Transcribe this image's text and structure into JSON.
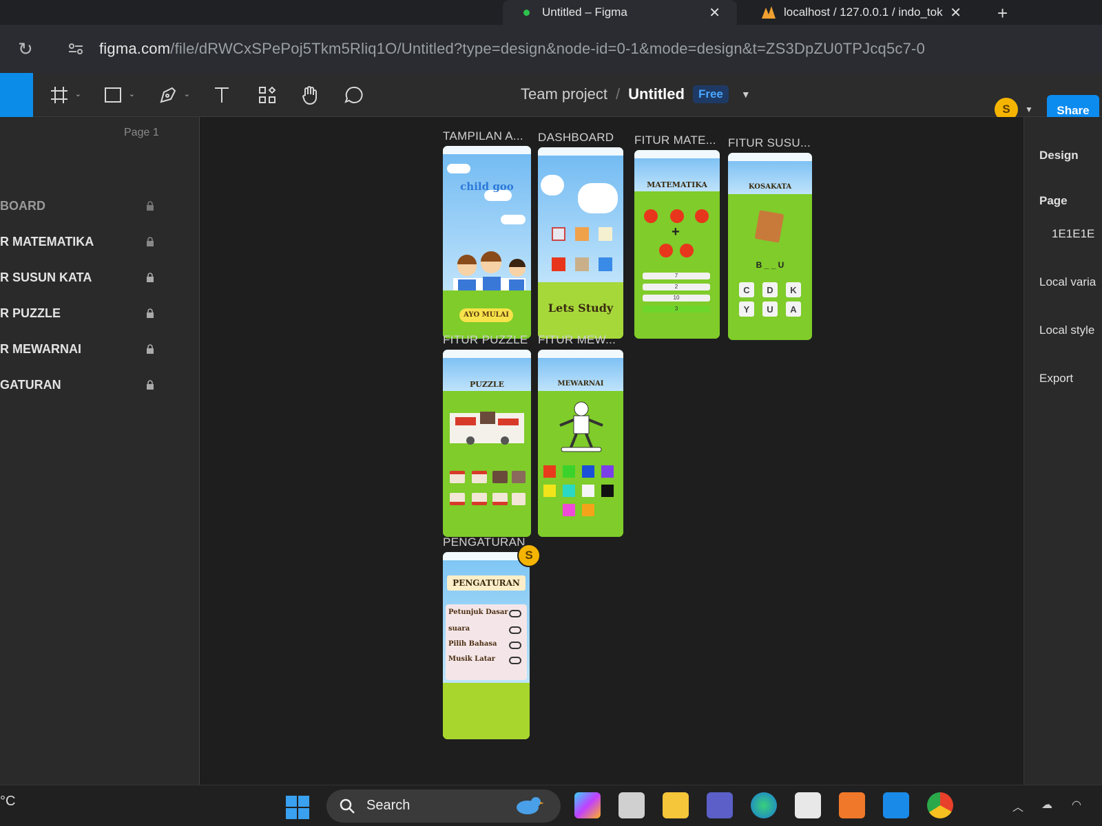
{
  "browser": {
    "tabs": [
      {
        "label": "Untitled – Figma"
      },
      {
        "label": "localhost / 127.0.0.1 / indo_tok"
      }
    ],
    "url_host": "figma.com",
    "url_path": "/file/dRWCxSPePoj5Tkm5Rliq1O/Untitled?type=design&node-id=0-1&mode=design&t=ZS3DpZU0TPJcq5c7-0"
  },
  "toolbar": {
    "project": "Team project",
    "separator": "/",
    "file": "Untitled",
    "plan_badge": "Free",
    "avatar_initial": "S",
    "share_label": "Share"
  },
  "left_panel": {
    "page_label": "Page 1",
    "layers": [
      {
        "label": "BOARD"
      },
      {
        "label": "R MATEMATIKA"
      },
      {
        "label": "R SUSUN KATA"
      },
      {
        "label": "R PUZZLE"
      },
      {
        "label": "R MEWARNAI"
      },
      {
        "label": "GATURAN"
      }
    ]
  },
  "canvas": {
    "frames": [
      {
        "title": "TAMPILAN A...",
        "text": "AYO MULAI"
      },
      {
        "title": "DASHBOARD",
        "text": "Lets Study"
      },
      {
        "title": "FITUR MATE...",
        "text": "MATEMATIKA",
        "answers": [
          "7",
          "2",
          "10",
          "3"
        ]
      },
      {
        "title": "FITUR SUSU...",
        "text": "KOSAKATA",
        "word": "B _ _ U",
        "letters": [
          "C",
          "D",
          "K",
          "Y",
          "U",
          "A"
        ]
      },
      {
        "title": "FITUR PUZZLE",
        "text": "PUZZLE"
      },
      {
        "title": "FITUR MEW...",
        "text": "MEWARNAI"
      },
      {
        "title": "PENGATURAN",
        "text": "PENGATURAN",
        "settings": [
          "Petunjuk Dasar",
          "suara",
          "Pilih Bahasa",
          "Musik Latar"
        ]
      }
    ],
    "collaborator_initial": "S",
    "color_swatches": [
      "#e83b1c",
      "#3bd32b",
      "#1a4fd8",
      "#7a3fe6",
      "#f2e41a",
      "#2bd8c4",
      "#f5f5f5",
      "#111111",
      "#f04ad8",
      "#f5a41a"
    ]
  },
  "right_panel": {
    "tab": "Design",
    "page_heading": "Page",
    "page_color": "1E1E1E",
    "local_variables": "Local varia",
    "local_styles": "Local style",
    "export": "Export"
  },
  "taskbar": {
    "weather": "°C",
    "search_placeholder": "Search"
  }
}
